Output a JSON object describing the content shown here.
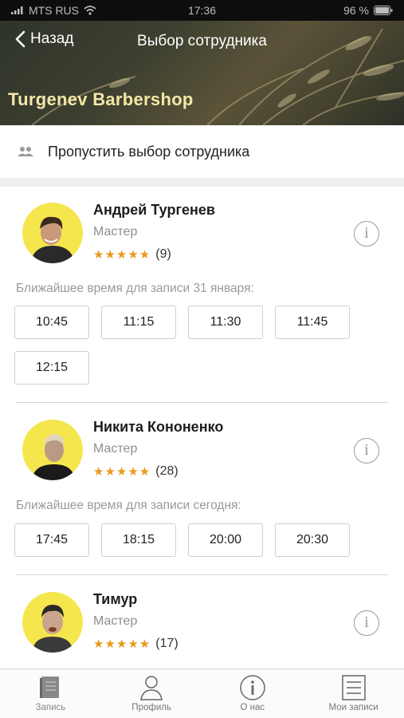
{
  "status_bar": {
    "carrier": "MTS RUS",
    "time": "17:36",
    "battery": "96 %"
  },
  "header": {
    "back_label": "Назад",
    "title": "Выбор сотрудника",
    "shop_name": "Turgenev Barbershop"
  },
  "skip": {
    "label": "Пропустить выбор сотрудника"
  },
  "employees": [
    {
      "name": "Андрей Тургенев",
      "role": "Мастер",
      "stars": "★★★★★",
      "reviews": "(9)",
      "nearest": "Ближайшее время для записи 31 января:",
      "slots": [
        "10:45",
        "11:15",
        "11:30",
        "11:45",
        "12:15"
      ]
    },
    {
      "name": "Никита Кононенко",
      "role": "Мастер",
      "stars": "★★★★★",
      "reviews": "(28)",
      "nearest": "Ближайшее время для записи сегодня:",
      "slots": [
        "17:45",
        "18:15",
        "20:00",
        "20:30"
      ]
    },
    {
      "name": "Тимур",
      "role": "Мастер",
      "stars": "★★★★★",
      "reviews": "(17)"
    }
  ],
  "tabbar": {
    "items": [
      {
        "label": "Запись",
        "icon": "book-icon"
      },
      {
        "label": "Профиль",
        "icon": "person-icon"
      },
      {
        "label": "О нас",
        "icon": "info-icon"
      },
      {
        "label": "Мои записи",
        "icon": "list-icon"
      }
    ]
  },
  "colors": {
    "accent_star": "#e89a1c",
    "avatar_bg": "#f6e64e",
    "shop_name": "#f3e7a8"
  }
}
